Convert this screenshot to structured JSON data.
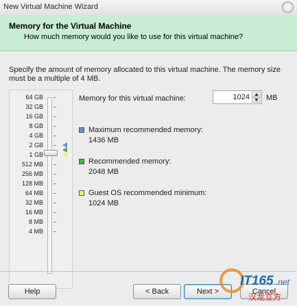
{
  "window": {
    "title": "New Virtual Machine Wizard"
  },
  "header": {
    "title": "Memory for the Virtual Machine",
    "subtitle": "How much memory would you like to use for this virtual machine?"
  },
  "description": "Specify the amount of memory allocated to this virtual machine. The memory size must be a multiple of 4 MB.",
  "slider": {
    "ticks": [
      "64 GB",
      "32 GB",
      "16 GB",
      "8 GB",
      "4 GB",
      "2 GB",
      "1 GB",
      "512 MB",
      "256 MB",
      "128 MB",
      "64 MB",
      "32 MB",
      "16 MB",
      "8 MB",
      "4 MB"
    ],
    "selected": "1 GB"
  },
  "memory_field": {
    "label": "Memory for this virtual machine:",
    "value": "1024",
    "unit": "MB"
  },
  "legend": [
    {
      "label": "Maximum recommended memory:",
      "value": "1436 MB",
      "color": "#6c8fd2"
    },
    {
      "label": "Recommended memory:",
      "value": "2048 MB",
      "color": "#49b34a"
    },
    {
      "label": "Guest OS recommended minimum:",
      "value": "1024 MB",
      "color": "#f0ee6d"
    }
  ],
  "buttons": {
    "help": "Help",
    "back": "< Back",
    "next": "Next >",
    "cancel": "Cancel"
  },
  "watermark": {
    "brand": "IT165",
    "suffix": ".net",
    "tagline": "汉龙立方"
  }
}
